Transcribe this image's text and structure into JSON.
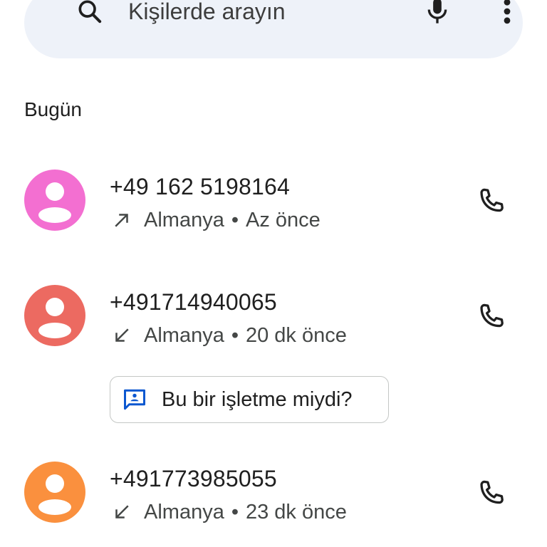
{
  "search": {
    "placeholder": "Kişilerde arayın"
  },
  "section": {
    "today_label": "Bugün"
  },
  "calls": [
    {
      "number": "+49 162 5198164",
      "country": "Almanya",
      "separator": "•",
      "time": "Az önce",
      "direction": "outgoing",
      "avatar_color": "#f36fd1"
    },
    {
      "number": "+491714940065",
      "country": "Almanya",
      "separator": "•",
      "time": "20 dk önce",
      "direction": "incoming",
      "avatar_color": "#ec6a61"
    },
    {
      "number": "+491773985055",
      "country": "Almanya",
      "separator": "•",
      "time": "23 dk önce",
      "direction": "incoming",
      "avatar_color": "#fa903e"
    }
  ],
  "business_prompt": {
    "label": "Bu bir işletme miydi?",
    "icon_color": "#0b57d0"
  },
  "icons": {
    "search": "search-icon",
    "mic": "microphone-icon",
    "more": "more-vert-icon",
    "call": "phone-icon",
    "outgoing": "arrow-up-right-icon",
    "incoming": "arrow-down-left-icon",
    "business": "business-message-icon"
  }
}
